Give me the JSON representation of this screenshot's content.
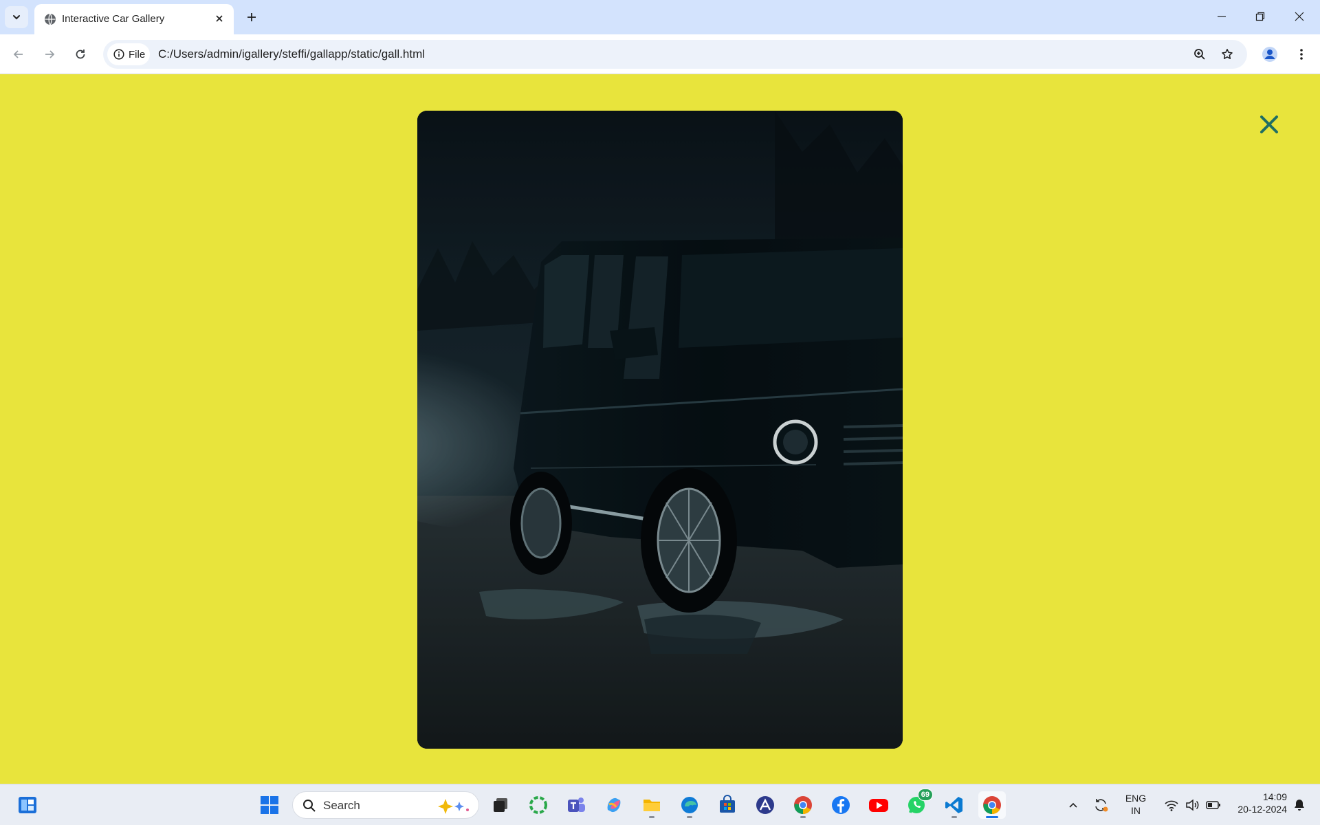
{
  "browser": {
    "tab_title": "Interactive Car Gallery",
    "address_chip": "File",
    "url": "C:/Users/admin/igallery/steffi/gallapp/static/gall.html"
  },
  "icons": {
    "tab_search": "chevron-down-icon",
    "favicon": "globe-icon",
    "tab_close": "close-icon",
    "new_tab": "plus-icon",
    "minimize": "minimize-icon",
    "restore": "restore-icon",
    "window_close": "close-icon",
    "back": "arrow-left-icon",
    "forward": "arrow-right-icon",
    "reload": "reload-icon",
    "site_info": "info-icon",
    "zoom": "zoom-icon",
    "bookmark": "star-icon",
    "profile": "profile-icon",
    "menu": "kebab-icon",
    "gallery_close": "close-x-icon"
  },
  "page": {
    "background": "#e8e43c",
    "close_color": "#1f6e63"
  },
  "gallery": {
    "image_subject": "dark SUV on muddy road with fog"
  },
  "taskbar": {
    "search_placeholder": "Search",
    "whatsapp_badge": "69",
    "language_line1": "ENG",
    "language_line2": "IN",
    "time": "14:09",
    "date": "20-12-2024"
  }
}
